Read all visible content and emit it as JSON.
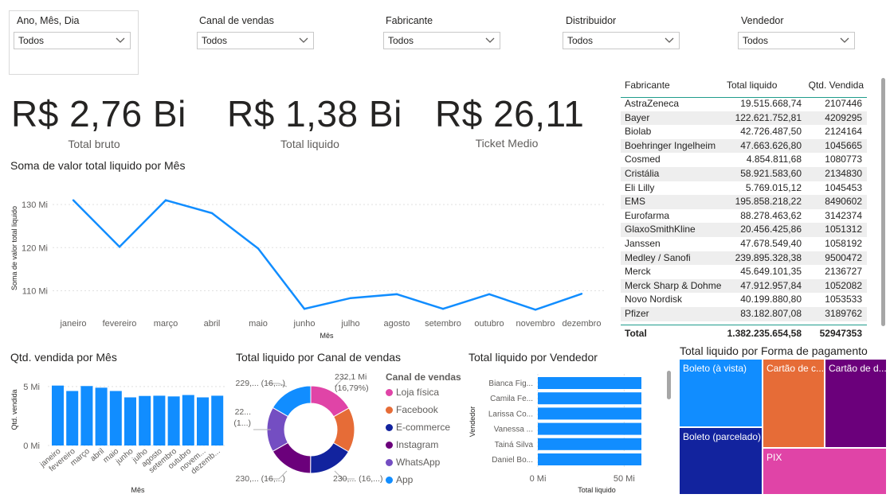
{
  "filters": [
    {
      "label": "Ano, Mês, Dia",
      "value": "Todos"
    },
    {
      "label": "Canal de vendas",
      "value": "Todos"
    },
    {
      "label": "Fabricante",
      "value": "Todos"
    },
    {
      "label": "Distribuidor",
      "value": "Todos"
    },
    {
      "label": "Vendedor",
      "value": "Todos"
    }
  ],
  "kpis": [
    {
      "value": "R$ 2,76 Bi",
      "label": "Total bruto"
    },
    {
      "value": "R$ 1,38 Bi",
      "label": "Total liquido"
    },
    {
      "value": "R$ 26,11",
      "label": "Ticket Medio"
    }
  ],
  "table": {
    "headers": [
      "Fabricante",
      "Total liquido",
      "Qtd. Vendida"
    ],
    "rows": [
      [
        "AstraZeneca",
        "19.515.668,74",
        "2107446"
      ],
      [
        "Bayer",
        "122.621.752,81",
        "4209295"
      ],
      [
        "Biolab",
        "42.726.487,50",
        "2124164"
      ],
      [
        "Boehringer Ingelheim",
        "47.663.626,80",
        "1045665"
      ],
      [
        "Cosmed",
        "4.854.811,68",
        "1080773"
      ],
      [
        "Cristália",
        "58.921.583,60",
        "2134830"
      ],
      [
        "Eli Lilly",
        "5.769.015,12",
        "1045453"
      ],
      [
        "EMS",
        "195.858.218,22",
        "8490602"
      ],
      [
        "Eurofarma",
        "88.278.463,62",
        "3142374"
      ],
      [
        "GlaxoSmithKline",
        "20.456.425,86",
        "1051312"
      ],
      [
        "Janssen",
        "47.678.549,40",
        "1058192"
      ],
      [
        "Medley / Sanofi",
        "239.895.328,38",
        "9500472"
      ],
      [
        "Merck",
        "45.649.101,35",
        "2136727"
      ],
      [
        "Merck Sharp & Dohme",
        "47.912.957,84",
        "1052082"
      ],
      [
        "Novo Nordisk",
        "40.199.880,80",
        "1053533"
      ],
      [
        "Pfizer",
        "83.182.807,08",
        "3189762"
      ]
    ],
    "total": [
      "Total",
      "1.382.235.654,58",
      "52947353"
    ]
  },
  "chart_data": [
    {
      "type": "line",
      "title": "Soma de valor total liquido por Mês",
      "xlabel": "Mês",
      "ylabel": "Soma de valor total liquido",
      "categories": [
        "janeiro",
        "fevereiro",
        "março",
        "abril",
        "maio",
        "junho",
        "julho",
        "agosto",
        "setembro",
        "outubro",
        "novembro",
        "dezembro"
      ],
      "values": [
        131,
        120.2,
        131,
        128,
        119.8,
        105.8,
        108.3,
        109.2,
        105.8,
        109.2,
        105.6,
        109.3
      ],
      "y_ticks": [
        "130 Mi",
        "120 Mi",
        "110 Mi"
      ],
      "ylim": [
        104,
        135
      ],
      "color": "#118DFF"
    },
    {
      "type": "bar",
      "title": "Qtd. vendida por Mês",
      "xlabel": "Mês",
      "ylabel": "Qtd. vendida",
      "categories": [
        "janeiro",
        "fevereiro",
        "março",
        "abril",
        "maio",
        "junho",
        "julho",
        "agosto",
        "setembro",
        "outubro",
        "novem...",
        "dezemb..."
      ],
      "values": [
        5.08,
        4.62,
        5.04,
        4.9,
        4.62,
        4.08,
        4.2,
        4.22,
        4.16,
        4.28,
        4.08,
        4.22
      ],
      "y_ticks": [
        "5 Mi",
        "0 Mi"
      ],
      "ylim": [
        0,
        5.8
      ],
      "color": "#118DFF"
    },
    {
      "type": "pie",
      "title": "Total liquido por Canal de vendas",
      "legend_title": "Canal de vendas",
      "labels": [
        "Loja física",
        "Facebook",
        "E-commerce",
        "Instagram",
        "WhatsApp",
        "App"
      ],
      "values": [
        16.79,
        16.6,
        16.6,
        16.6,
        16.6,
        16.6
      ],
      "colors": [
        "#E044A7",
        "#E66C37",
        "#12239E",
        "#6B007B",
        "#744EC2",
        "#118DFF"
      ],
      "data_labels": [
        "232,1 Mi",
        "(16,79%)",
        "230,... (16,...)",
        "230,... (16,...)",
        "22...",
        "(1...)",
        "229,... (16,...)"
      ]
    },
    {
      "type": "bar",
      "orientation": "horizontal",
      "title": "Total liquido por Vendedor",
      "xlabel": "Total liquido",
      "ylabel": "Vendedor",
      "categories": [
        "Bianca Fig...",
        "Camila Fe...",
        "Larissa Co...",
        "Vanessa ...",
        "Tainá Silva",
        "Daniel Bo..."
      ],
      "values": [
        60,
        60,
        60,
        60,
        60,
        60
      ],
      "x_ticks": [
        "0 Mi",
        "50 Mi"
      ],
      "xlim": [
        0,
        60
      ],
      "color": "#118DFF"
    },
    {
      "type": "treemap",
      "title": "Total liquido por Forma de pagamento",
      "labels": [
        "Boleto (à vista)",
        "Boleto (parcelado)",
        "Cartão de c...",
        "Cartão de d...",
        "PIX"
      ],
      "colors": [
        "#118DFF",
        "#12239E",
        "#E66C37",
        "#6B007B",
        "#E044A7"
      ]
    }
  ]
}
